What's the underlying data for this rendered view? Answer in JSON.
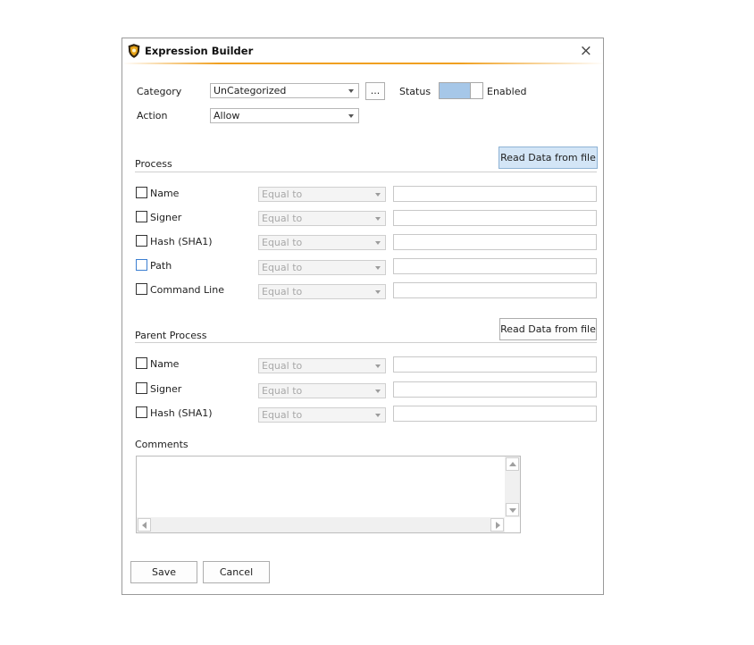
{
  "window": {
    "title": "Expression Builder"
  },
  "top": {
    "category_label": "Category",
    "category_value": "UnCategorized",
    "more_button": "...",
    "status_label": "Status",
    "status_value": "Enabled",
    "action_label": "Action",
    "action_value": "Allow"
  },
  "process": {
    "section_label": "Process",
    "read_button": "Read Data from file",
    "rows": [
      {
        "label": "Name",
        "operator": "Equal to"
      },
      {
        "label": "Signer",
        "operator": "Equal to"
      },
      {
        "label": "Hash (SHA1)",
        "operator": "Equal to"
      },
      {
        "label": "Path",
        "operator": "Equal to"
      },
      {
        "label": "Command Line",
        "operator": "Equal to"
      }
    ]
  },
  "parent_process": {
    "section_label": "Parent Process",
    "read_button": "Read Data from file",
    "rows": [
      {
        "label": "Name",
        "operator": "Equal to"
      },
      {
        "label": "Signer",
        "operator": "Equal to"
      },
      {
        "label": "Hash (SHA1)",
        "operator": "Equal to"
      }
    ]
  },
  "comments": {
    "label": "Comments"
  },
  "footer": {
    "save_label": "Save",
    "cancel_label": "Cancel"
  },
  "colors": {
    "accent_rule": "#f0a020",
    "toggle_on": "#a6c7e8",
    "button_highlight": "#d3e5f6"
  }
}
